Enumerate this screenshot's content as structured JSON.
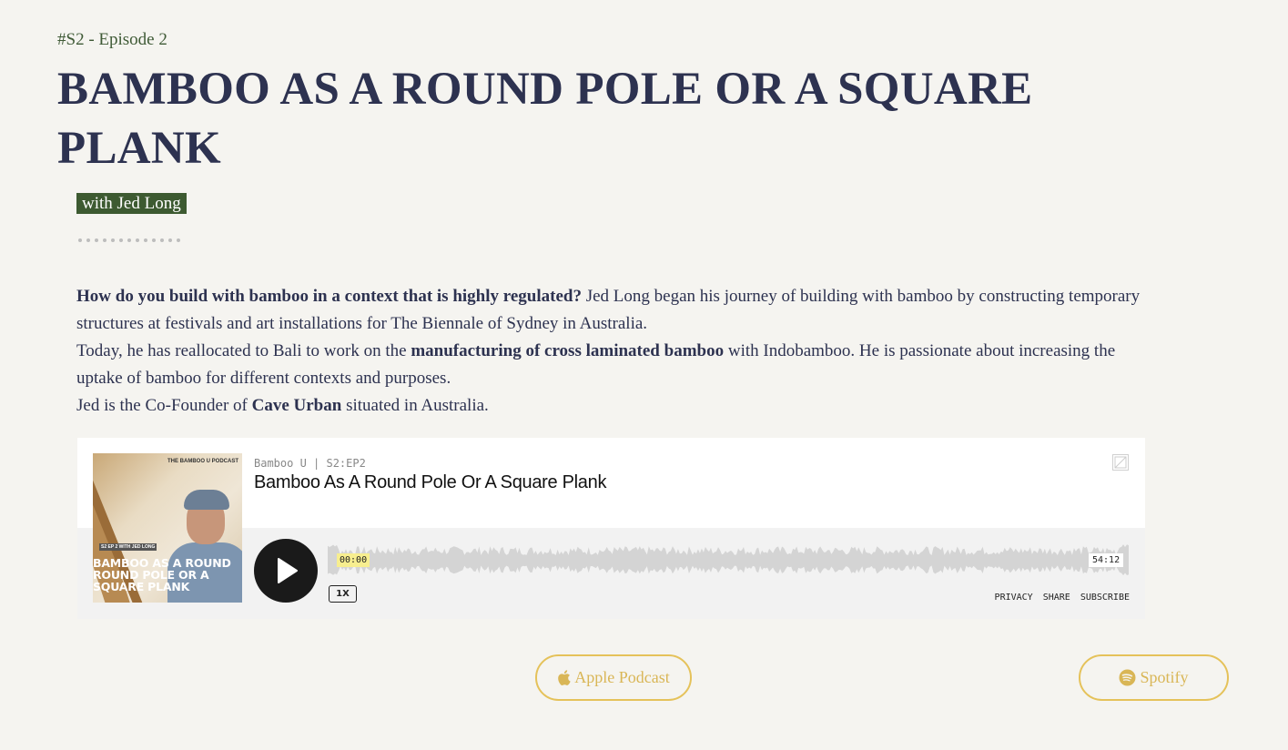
{
  "episode_tag": "#S2 - Episode 2",
  "title": "BAMBOO AS A ROUND POLE OR A SQUARE PLANK",
  "guest_badge": "with Jed Long",
  "description": {
    "p1_bold": "How do you build with bamboo in a context that is highly regulated?",
    "p1_rest": " Jed Long began his journey of building with bamboo by constructing temporary structures at festivals and art installations for The Biennale of Sydney in Australia.",
    "p2_start": "Today, he has reallocated to Bali to work on the ",
    "p2_bold": "manufacturing of cross laminated bamboo",
    "p2_rest": " with Indobamboo. He is passionate about increasing the uptake of bamboo for different contexts and purposes.",
    "p3_start": "Jed is the Co-Founder of ",
    "p3_bold": "Cave Urban",
    "p3_rest": " situated in Australia."
  },
  "player": {
    "cover_label": "THE BAMBOO U PODCAST",
    "cover_tag": "S2 EP 2 WITH JED LONG",
    "cover_title": "BAMBOO AS A ROUND ROUND POLE OR A SQUARE PLANK",
    "meta": "Bamboo U | S2:EP2",
    "episode_title": "Bamboo As A Round Pole Or A Square Plank",
    "current_time": "00:00",
    "total_time": "54:12",
    "progress": 0,
    "speed": "1X",
    "links": [
      "PRIVACY",
      "SHARE",
      "SUBSCRIBE"
    ]
  },
  "buttons": {
    "apple_label": "Apple Podcast",
    "spotify_label": "Spotify"
  },
  "colors": {
    "background": "#f5f4f0",
    "title": "#2d3250",
    "accent_green": "#3d5a31",
    "button_gold": "#e5c25a"
  },
  "icons": [
    "apple-icon",
    "spotify-icon",
    "play-icon",
    "image-icon"
  ]
}
